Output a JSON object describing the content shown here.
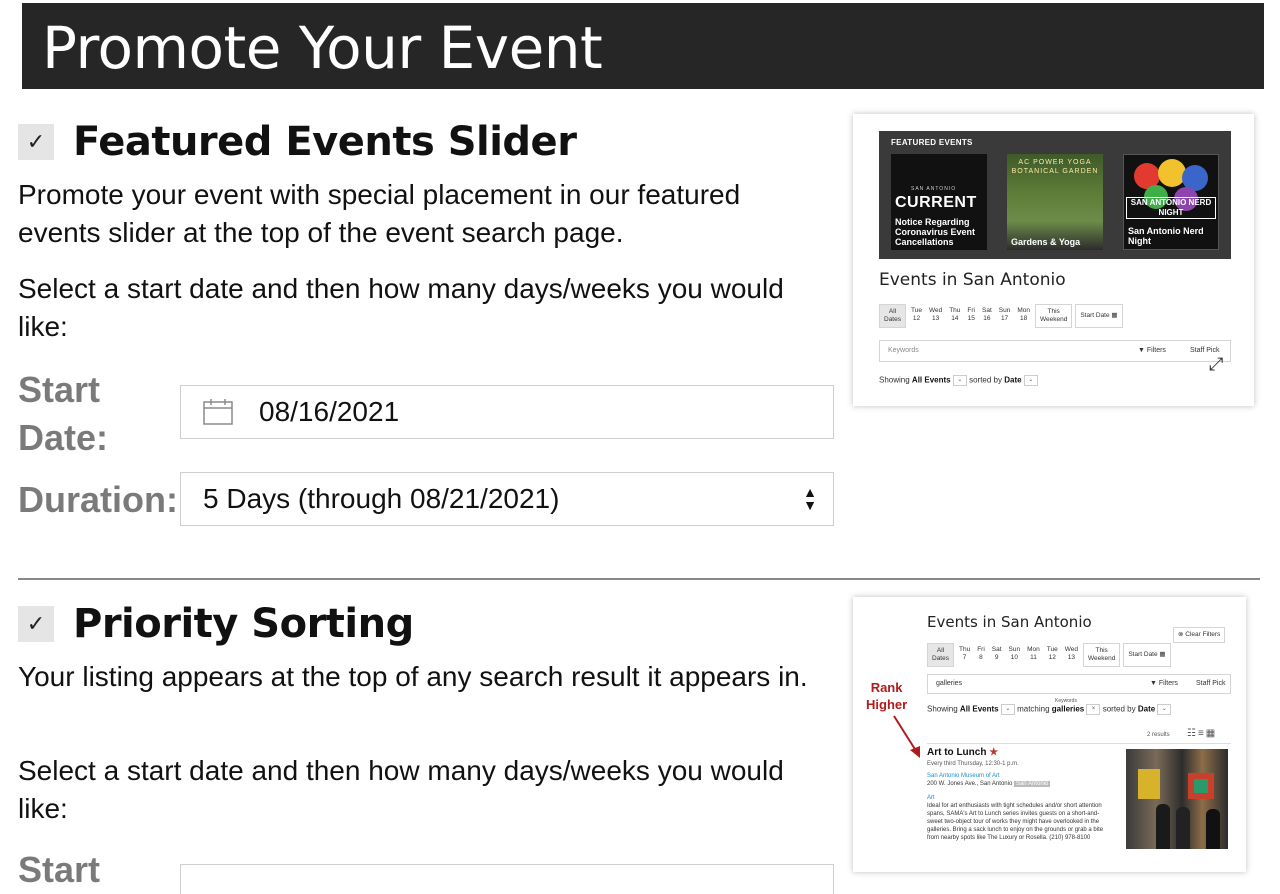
{
  "banner": {
    "title": "Promote Your Event"
  },
  "featured": {
    "checkbox": "✓",
    "heading": "Featured Events Slider",
    "description": "Promote your event with special placement in our featured events slider at the top of the event search page.",
    "instruction": "Select a start date and then how many days/weeks you would like:",
    "start_date_label": "Start Date:",
    "start_date_value": "08/16/2021",
    "duration_label": "Duration:",
    "duration_value": "5 Days (through 08/21/2021)"
  },
  "priority": {
    "checkbox": "✓",
    "heading": "Priority Sorting",
    "description": "Your listing appears at the top of any search result it appears in.",
    "instruction": "Select a start date and then how many days/weeks you would like:",
    "start_date_label": "Start"
  },
  "preview_featured": {
    "band_title": "FEATURED EVENTS",
    "tiles": [
      {
        "caption": "Notice Regarding Coronavirus Event Cancellations",
        "logo": "CURRENT",
        "logo_small": "SAN ANTONIO"
      },
      {
        "caption": "Gardens & Yoga",
        "top": "AC POWER YOGA BOTANICAL GARDEN"
      },
      {
        "caption": "San Antonio Nerd Night",
        "top": "SAN ANTONIO NERD NIGHT"
      }
    ],
    "heading": "Events in San Antonio",
    "dates": [
      {
        "top": "All",
        "bottom": "Dates"
      },
      {
        "top": "Tue",
        "bottom": "12"
      },
      {
        "top": "Wed",
        "bottom": "13"
      },
      {
        "top": "Thu",
        "bottom": "14"
      },
      {
        "top": "Fri",
        "bottom": "15"
      },
      {
        "top": "Sat",
        "bottom": "16"
      },
      {
        "top": "Sun",
        "bottom": "17"
      },
      {
        "top": "Mon",
        "bottom": "18"
      },
      {
        "top": "This",
        "bottom": "Weekend"
      }
    ],
    "start_date_btn": "Start Date",
    "keywords_placeholder": "Keywords",
    "filters": "Filters",
    "staff_pick": "Staff Pick",
    "showing": "Showing",
    "all_events": "All Events",
    "sorted_by": "sorted by",
    "sort_value": "Date"
  },
  "preview_priority": {
    "heading": "Events in San Antonio",
    "clear_filters": "Clear Filters",
    "dates": [
      {
        "top": "All",
        "bottom": "Dates"
      },
      {
        "top": "Thu",
        "bottom": "7"
      },
      {
        "top": "Fri",
        "bottom": "8"
      },
      {
        "top": "Sat",
        "bottom": "9"
      },
      {
        "top": "Sun",
        "bottom": "10"
      },
      {
        "top": "Mon",
        "bottom": "11"
      },
      {
        "top": "Tue",
        "bottom": "12"
      },
      {
        "top": "Wed",
        "bottom": "13"
      },
      {
        "top": "This",
        "bottom": "Weekend"
      }
    ],
    "start_date_btn": "Start Date",
    "keyword_value": "galleries",
    "keywords_small": "Keywords",
    "filters": "Filters",
    "staff_pick": "Staff Pick",
    "showing": "Showing",
    "all_events": "All Events",
    "matching": "matching",
    "match_value": "galleries",
    "sorted_by": "sorted by",
    "sort_value": "Date",
    "results": "2 results",
    "rank_line1": "Rank",
    "rank_line2": "Higher",
    "result": {
      "title": "Art to Lunch",
      "schedule": "Every third Thursday, 12:30-1 p.m.",
      "venue": "San Antonio Museum of Art",
      "address": "200 W. Jones Ave., San Antonio",
      "area": "San Antonio",
      "category": "Art",
      "blurb": "Ideal for art enthusiasts with tight schedules and/or short attention spans, SAMA's Art to Lunch series invites guests on a short-and-sweet two-object tour of works they might have overlooked in the galleries. Bring a sack lunch to enjoy on the grounds or grab a bite from nearby spots like The Luxury or Rosella. (210) 978-8100"
    }
  }
}
